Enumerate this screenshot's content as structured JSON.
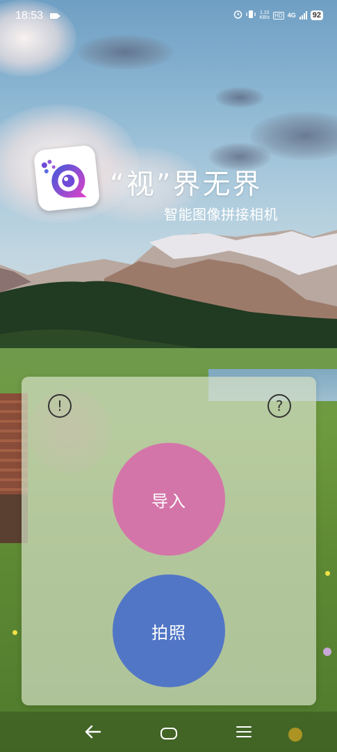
{
  "status_bar": {
    "time": "18:53",
    "net_speed_value": "1.10",
    "net_speed_unit": "KB/s",
    "hd_label": "HD",
    "network_label": "4G",
    "battery_level": "92"
  },
  "branding": {
    "title": "“视”界无界",
    "subtitle": "智能图像拼接相机"
  },
  "panel": {
    "import_label": "导入",
    "camera_label": "拍照",
    "info_glyph": "!",
    "help_glyph": "?"
  },
  "colors": {
    "import_button": "#d475a9",
    "camera_button": "#5276c6",
    "panel_background": "#d2dec4",
    "logo_gradient_start": "#3b5bdb",
    "logo_gradient_end": "#e040c8"
  },
  "icons": {
    "status_left": [
      "video-recording-icon"
    ],
    "status_right": [
      "alarm-icon",
      "vibrate-icon",
      "hd-icon",
      "signal-icon",
      "battery-icon"
    ],
    "panel": [
      "info-icon",
      "help-icon"
    ],
    "nav": [
      "back-icon",
      "home-icon",
      "menu-icon"
    ]
  }
}
